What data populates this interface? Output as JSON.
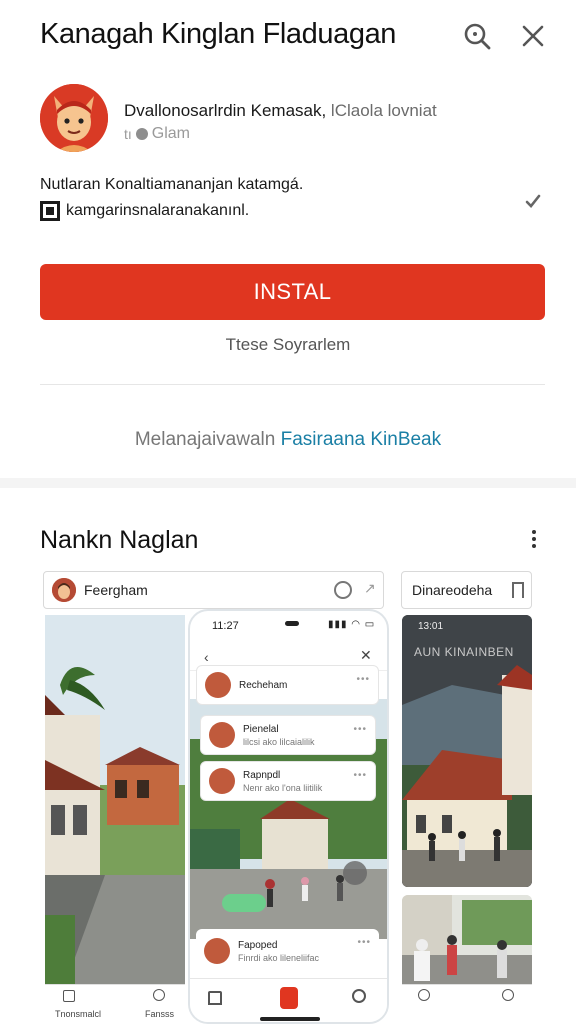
{
  "header": {
    "title": "Kanagah Kinglan Fladuagan",
    "search_icon": "search-icon",
    "close_icon": "close-icon"
  },
  "developer": {
    "name": "Dvallonosarlrdin Kemasak,",
    "name_secondary": " lClaola lovniat",
    "sub": "Glam",
    "avatar_icon": "fox-avatar"
  },
  "description": {
    "line1": "Nutlaran Konaltiamananjan katamgá.",
    "line2": "kamgarinsnalaranakanınl."
  },
  "actions": {
    "install_label": "INSTAL",
    "secondary_label": "Ttese Soyrarlem",
    "more_prefix": "Melanajaivawaln",
    "more_link": "Fasiraana KinBeak",
    "install_color": "#e03620",
    "link_color": "#1a7fa5"
  },
  "gallery": {
    "section_title": "Nankn Naglan",
    "chip_left_label": "Feergham",
    "chip_right_label": "Dinareodeha",
    "phone": {
      "time": "11:27",
      "post1_name": "Recheham",
      "post2_name": "Pienelal",
      "post2_sub": "lilcsi ako lilcaialilik",
      "post3_name": "Rapnpdl",
      "post3_sub": "Nenr ako l'ona liitilik",
      "post4_name": "Fapoped",
      "post4_sub": "Finrdi ako lileneliifac"
    },
    "right_overlay": "AUN KINAINBEN",
    "right_time": "13:01",
    "left_tab1": "Tnonsmalcl",
    "left_tab2": "Fansss"
  }
}
